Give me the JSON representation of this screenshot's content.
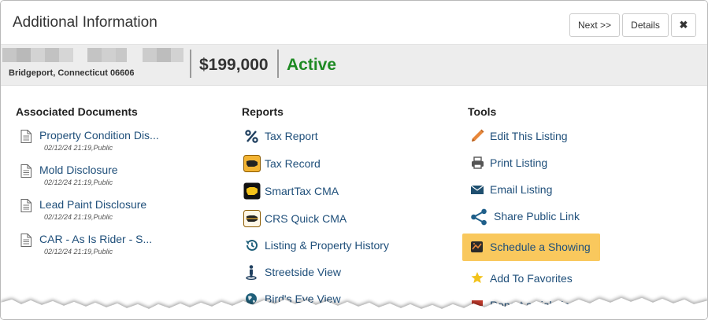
{
  "modal": {
    "title": "Additional Information",
    "buttons": {
      "next": "Next >>",
      "details": "Details",
      "close": "✖"
    }
  },
  "listing": {
    "address": "Bridgeport, Connecticut 06606",
    "price": "$199,000",
    "status": "Active",
    "status_color": "#1e8a23"
  },
  "documents": {
    "title": "Associated Documents",
    "items": [
      {
        "name": "Property Condition Dis...",
        "meta": "02/12/24 21:19,Public"
      },
      {
        "name": "Mold Disclosure",
        "meta": "02/12/24 21:19,Public"
      },
      {
        "name": "Lead Paint Disclosure",
        "meta": "02/12/24 21:19,Public"
      },
      {
        "name": "CAR - As Is Rider - S...",
        "meta": "02/12/24 21:19,Public"
      }
    ]
  },
  "reports": {
    "title": "Reports",
    "items": [
      {
        "label": "Tax Report",
        "icon": "percent-icon"
      },
      {
        "label": "Tax Record",
        "icon": "tax-record-icon"
      },
      {
        "label": "SmartTax CMA",
        "icon": "smarttax-icon"
      },
      {
        "label": "CRS Quick CMA",
        "icon": "crs-cma-icon"
      },
      {
        "label": "Listing & Property History",
        "icon": "history-icon"
      },
      {
        "label": "Streetside View",
        "icon": "street-person-icon"
      },
      {
        "label": "Bird's Eye View",
        "icon": "globe-icon"
      }
    ]
  },
  "tools": {
    "title": "Tools",
    "highlight_color": "#f9c85d",
    "items": [
      {
        "label": "Edit This Listing",
        "icon": "pencil-icon"
      },
      {
        "label": "Print Listing",
        "icon": "printer-icon"
      },
      {
        "label": "Email Listing",
        "icon": "envelope-icon"
      },
      {
        "label": "Share Public Link",
        "icon": "share-icon"
      },
      {
        "label": "Schedule a Showing",
        "icon": "showing-icon"
      },
      {
        "label": "Add To Favorites",
        "icon": "star-icon"
      },
      {
        "label": "Report a violation",
        "icon": "flag-icon"
      }
    ]
  }
}
